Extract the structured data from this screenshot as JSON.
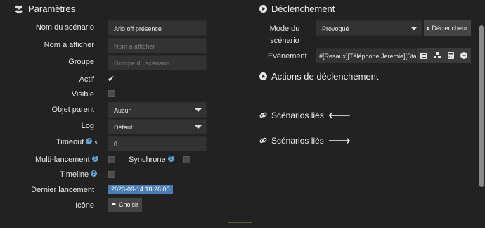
{
  "left": {
    "title": "Paramètres",
    "rows": {
      "name": {
        "label": "Nom du scénario",
        "value": "Arlo off présence"
      },
      "display": {
        "label": "Nom à afficher",
        "placeholder": "Nom à afficher"
      },
      "group": {
        "label": "Groupe",
        "placeholder": "Groupe du scénario"
      },
      "active": {
        "label": "Actif"
      },
      "visible": {
        "label": "Visible"
      },
      "parent": {
        "label": "Objet parent",
        "value": "Aucun"
      },
      "log": {
        "label": "Log",
        "value": "Défaut"
      },
      "timeout": {
        "label": "Timeout",
        "unit": "s",
        "value": "0"
      },
      "multi": {
        "label": "Multi-lancement"
      },
      "sync": {
        "label": "Synchrone"
      },
      "timeline": {
        "label": "Timeline"
      },
      "last": {
        "label": "Dernier lancement",
        "value": "2023-09-14 18:26:05"
      },
      "icon": {
        "label": "Icône",
        "button": "Choisir"
      }
    }
  },
  "right": {
    "trigger_title": "Déclenchement",
    "mode_label_1": "Mode du",
    "mode_label_2": "scénario",
    "mode_value": "Provoqué",
    "trigger_button": "Déclencheur",
    "event_label": "Evénement",
    "event_value": "#[Resaux][Téléphone Jeremie][Statut]#",
    "actions_title": "Actions de déclenchement",
    "linked_1": "Scénarios liés",
    "linked_2": "Scénarios liés"
  }
}
